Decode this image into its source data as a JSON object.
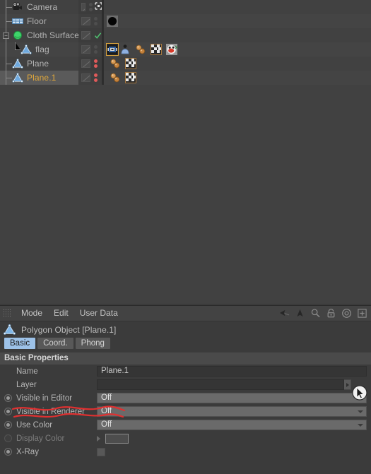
{
  "object_manager": {
    "rows": [
      {
        "label": "Camera",
        "icon": "camera-icon",
        "indent": 1,
        "visibility": "neutral",
        "tags": [],
        "selected": false,
        "check": false,
        "move_gizmo": true
      },
      {
        "label": "Floor",
        "icon": "floor-icon",
        "indent": 1,
        "visibility": "neutral",
        "tags": [
          "black-sphere-thumbnail"
        ],
        "selected": false,
        "check": false,
        "move_gizmo": false
      },
      {
        "label": "Cloth Surface",
        "icon": "cloth-surface-icon",
        "indent": 0,
        "visibility": "neutral",
        "tags": [],
        "selected": false,
        "check": true,
        "move_gizmo": false
      },
      {
        "label": "flag",
        "icon": "polygon-object-icon",
        "indent": 2,
        "visibility": "neutral",
        "tags": [
          "cloth-tag",
          "cloth-belt-tag",
          "phong-tag",
          "material-tag",
          "texture-preview-tag"
        ],
        "selected": false,
        "check": false,
        "move_gizmo": false
      },
      {
        "label": "Plane",
        "icon": "polygon-object-icon",
        "indent": 1,
        "visibility": "red",
        "tags": [
          "phong-tag",
          "material-tag"
        ],
        "selected": false,
        "check": false,
        "move_gizmo": false
      },
      {
        "label": "Plane.1",
        "icon": "polygon-object-icon",
        "indent": 1,
        "visibility": "red",
        "tags": [
          "phong-tag",
          "material-tag"
        ],
        "selected": true,
        "check": false,
        "move_gizmo": false
      }
    ]
  },
  "attribute_manager": {
    "menu": [
      "Mode",
      "Edit",
      "User Data"
    ],
    "toolbar_icons": [
      "back-arrow-icon",
      "forward-arrow-icon",
      "search-icon",
      "lock-icon",
      "target-icon",
      "add-icon"
    ],
    "object_header": "Polygon Object [Plane.1]",
    "tabs": [
      {
        "label": "Basic",
        "active": true
      },
      {
        "label": "Coord.",
        "active": false
      },
      {
        "label": "Phong",
        "active": false
      }
    ],
    "section_title": "Basic Properties",
    "properties": [
      {
        "name": "Name",
        "value": "Plane.1",
        "type": "text",
        "radio": "none",
        "enabled": true
      },
      {
        "name": "Layer",
        "value": "",
        "type": "layer",
        "radio": "none",
        "enabled": true
      },
      {
        "name": "Visible in Editor",
        "value": "Off",
        "type": "combo",
        "radio": "on",
        "enabled": true
      },
      {
        "name": "Visible in Renderer",
        "value": "Off",
        "type": "combo",
        "radio": "on",
        "enabled": true
      },
      {
        "name": "Use Color",
        "value": "Off",
        "type": "combo",
        "radio": "on",
        "enabled": true
      },
      {
        "name": "Display Color",
        "value": "",
        "type": "color",
        "radio": "dim",
        "enabled": false
      },
      {
        "name": "X-Ray",
        "value": "",
        "type": "checkbox",
        "radio": "on",
        "enabled": true
      }
    ]
  },
  "annotation": {
    "type": "red-wavy-underline",
    "color": "#e03030",
    "targets": [
      "Visible in Editor",
      "Visible in Renderer"
    ]
  },
  "colors": {
    "panel_bg": "#3b3b3b",
    "object_manager_bg": "#414141",
    "row_selected": "#5a5a5a",
    "highlight_text": "#e0a83c",
    "tab_active": "#9dc2e8",
    "annotation_red": "#e03030",
    "visibility_red": "#e05a5a",
    "check_green": "#4fbf6f"
  }
}
